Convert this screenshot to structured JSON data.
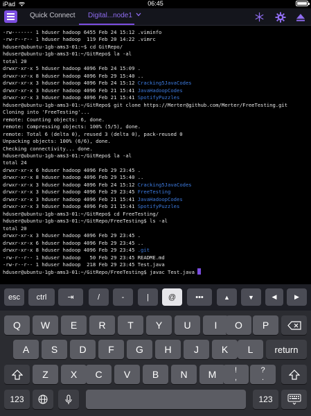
{
  "status_bar": {
    "device": "iPad",
    "wifi_icon": "wifi-icon",
    "time": "06:45",
    "battery_icon": "battery-icon"
  },
  "toolbar": {
    "menu_icon": "hamburger-menu-icon",
    "tabs": [
      {
        "label": "Quick Connect",
        "active": false
      },
      {
        "label": "Digital...node1",
        "active": true
      }
    ],
    "active_color": "#8f6cf0",
    "accent": "#7b4de0",
    "icons": [
      "star-burst-icon",
      "gear-icon",
      "eject-icon"
    ]
  },
  "terminal": {
    "prompt_base": "hduser@ubuntu-1gb-ams3-01:~$",
    "lines": [
      {
        "text": "-rw------- 1 hduser hadoop 6455 Feb 24 15:12 .viminfo"
      },
      {
        "text": "-rw-r--r-- 1 hduser hadoop  119 Feb 20 14:22 .vimrc"
      },
      {
        "text": "hduser@ubuntu-1gb-ams3-01:~$ cd GitRepo/"
      },
      {
        "text": "hduser@ubuntu-1gb-ams3-01:~/GitRepo$ la -al"
      },
      {
        "text": "total 20"
      },
      {
        "text": "drwxr-xr-x 5 hduser hadoop 4096 Feb 24 15:09 ."
      },
      {
        "text": "drwxr-xr-x 8 hduser hadoop 4096 Feb 29 15:40 .."
      },
      {
        "text": "drwxr-xr-x 3 hduser hadoop 4096 Feb 24 15:12 ",
        "blue": "Cracking5JavaCodes"
      },
      {
        "text": "drwxr-xr-x 3 hduser hadoop 4096 Feb 21 15:41 ",
        "blue": "JavaHadoopCodes"
      },
      {
        "text": "drwxr-xr-x 3 hduser hadoop 4096 Feb 21 15:41 ",
        "blue": "SpotifyPuzzles"
      },
      {
        "text": "hduser@ubuntu-1gb-ams3-01:~/GitRepo$ git clone https://Merter@github.com/Merter/FreeTesting.git"
      },
      {
        "text": "Cloning into 'FreeTesting'..."
      },
      {
        "text": "remote: Counting objects: 6, done."
      },
      {
        "text": "remote: Compressing objects: 100% (5/5), done."
      },
      {
        "text": "remote: Total 6 (delta 0), reused 3 (delta 0), pack-reused 0"
      },
      {
        "text": "Unpacking objects: 100% (6/6), done."
      },
      {
        "text": "Checking connectivity... done."
      },
      {
        "text": "hduser@ubuntu-1gb-ams3-01:~/GitRepo$ la -al"
      },
      {
        "text": "total 24"
      },
      {
        "text": "drwxr-xr-x 6 hduser hadoop 4096 Feb 29 23:45 ."
      },
      {
        "text": "drwxr-xr-x 8 hduser hadoop 4096 Feb 29 15:40 .."
      },
      {
        "text": "drwxr-xr-x 3 hduser hadoop 4096 Feb 24 15:12 ",
        "blue": "Cracking5JavaCodes"
      },
      {
        "text": "drwxr-xr-x 3 hduser hadoop 4096 Feb 29 23:45 ",
        "blue": "FreeTesting"
      },
      {
        "text": "drwxr-xr-x 3 hduser hadoop 4096 Feb 21 15:41 ",
        "blue": "JavaHadoopCodes"
      },
      {
        "text": "drwxr-xr-x 3 hduser hadoop 4096 Feb 21 15:41 ",
        "blue": "SpotifyPuzzles"
      },
      {
        "text": "hduser@ubuntu-1gb-ams3-01:~/GitRepo$ cd FreeTesting/"
      },
      {
        "text": "hduser@ubuntu-1gb-ams3-01:~/GitRepo/FreeTesting$ ls -al"
      },
      {
        "text": "total 20"
      },
      {
        "text": "drwxr-xr-x 3 hduser hadoop 4096 Feb 29 23:45 ."
      },
      {
        "text": "drwxr-xr-x 6 hduser hadoop 4096 Feb 29 23:45 .."
      },
      {
        "text": "drwxr-xr-x 8 hduser hadoop 4096 Feb 29 23:45 ",
        "blue": ".git"
      },
      {
        "text": "-rw-r--r-- 1 hduser hadoop   50 Feb 29 23:45 README.md"
      },
      {
        "text": "-rw-r--r-- 1 hduser hadoop  218 Feb 29 23:45 Test.java"
      },
      {
        "text": "hduser@ubuntu-1gb-ams3-01:~/GitRepo/FreeTesting$ javac Test.java ",
        "cursor": true
      }
    ],
    "link_color": "#3d7be0"
  },
  "accessory_row": {
    "keys": [
      {
        "label": "esc",
        "name": "esc-key"
      },
      {
        "label": "ctrl",
        "name": "ctrl-key"
      },
      {
        "label": "⇥",
        "name": "tab-key"
      },
      {
        "label": "/",
        "name": "slash-key"
      },
      {
        "label": "-",
        "name": "dash-key"
      },
      {
        "label": "|",
        "name": "pipe-key"
      },
      {
        "label": "@",
        "name": "at-key"
      },
      {
        "label": "•••",
        "name": "more-keys-button"
      },
      {
        "label": "▲",
        "name": "arrow-up-key"
      },
      {
        "label": "▼",
        "name": "arrow-down-key"
      },
      {
        "label": "◀",
        "name": "arrow-left-key"
      },
      {
        "label": "▶",
        "name": "arrow-right-key"
      }
    ]
  },
  "keyboard": {
    "row1": [
      "Q",
      "W",
      "E",
      "R",
      "T",
      "Y",
      "U",
      "I",
      "O",
      "P"
    ],
    "row2": [
      "A",
      "S",
      "D",
      "F",
      "G",
      "H",
      "J",
      "K",
      "L"
    ],
    "row3": [
      "Z",
      "X",
      "C",
      "V",
      "B",
      "N",
      "M"
    ],
    "backspace_icon": "backspace-icon",
    "return_label": "return",
    "shift_icon": "shift-icon",
    "punct_1": {
      "top": "!",
      "bottom": ","
    },
    "punct_2": {
      "top": "?",
      "bottom": "."
    },
    "numbers_label": "123",
    "globe_icon": "globe-icon",
    "mic_icon": "microphone-icon",
    "hide_keyboard_icon": "hide-keyboard-icon"
  }
}
